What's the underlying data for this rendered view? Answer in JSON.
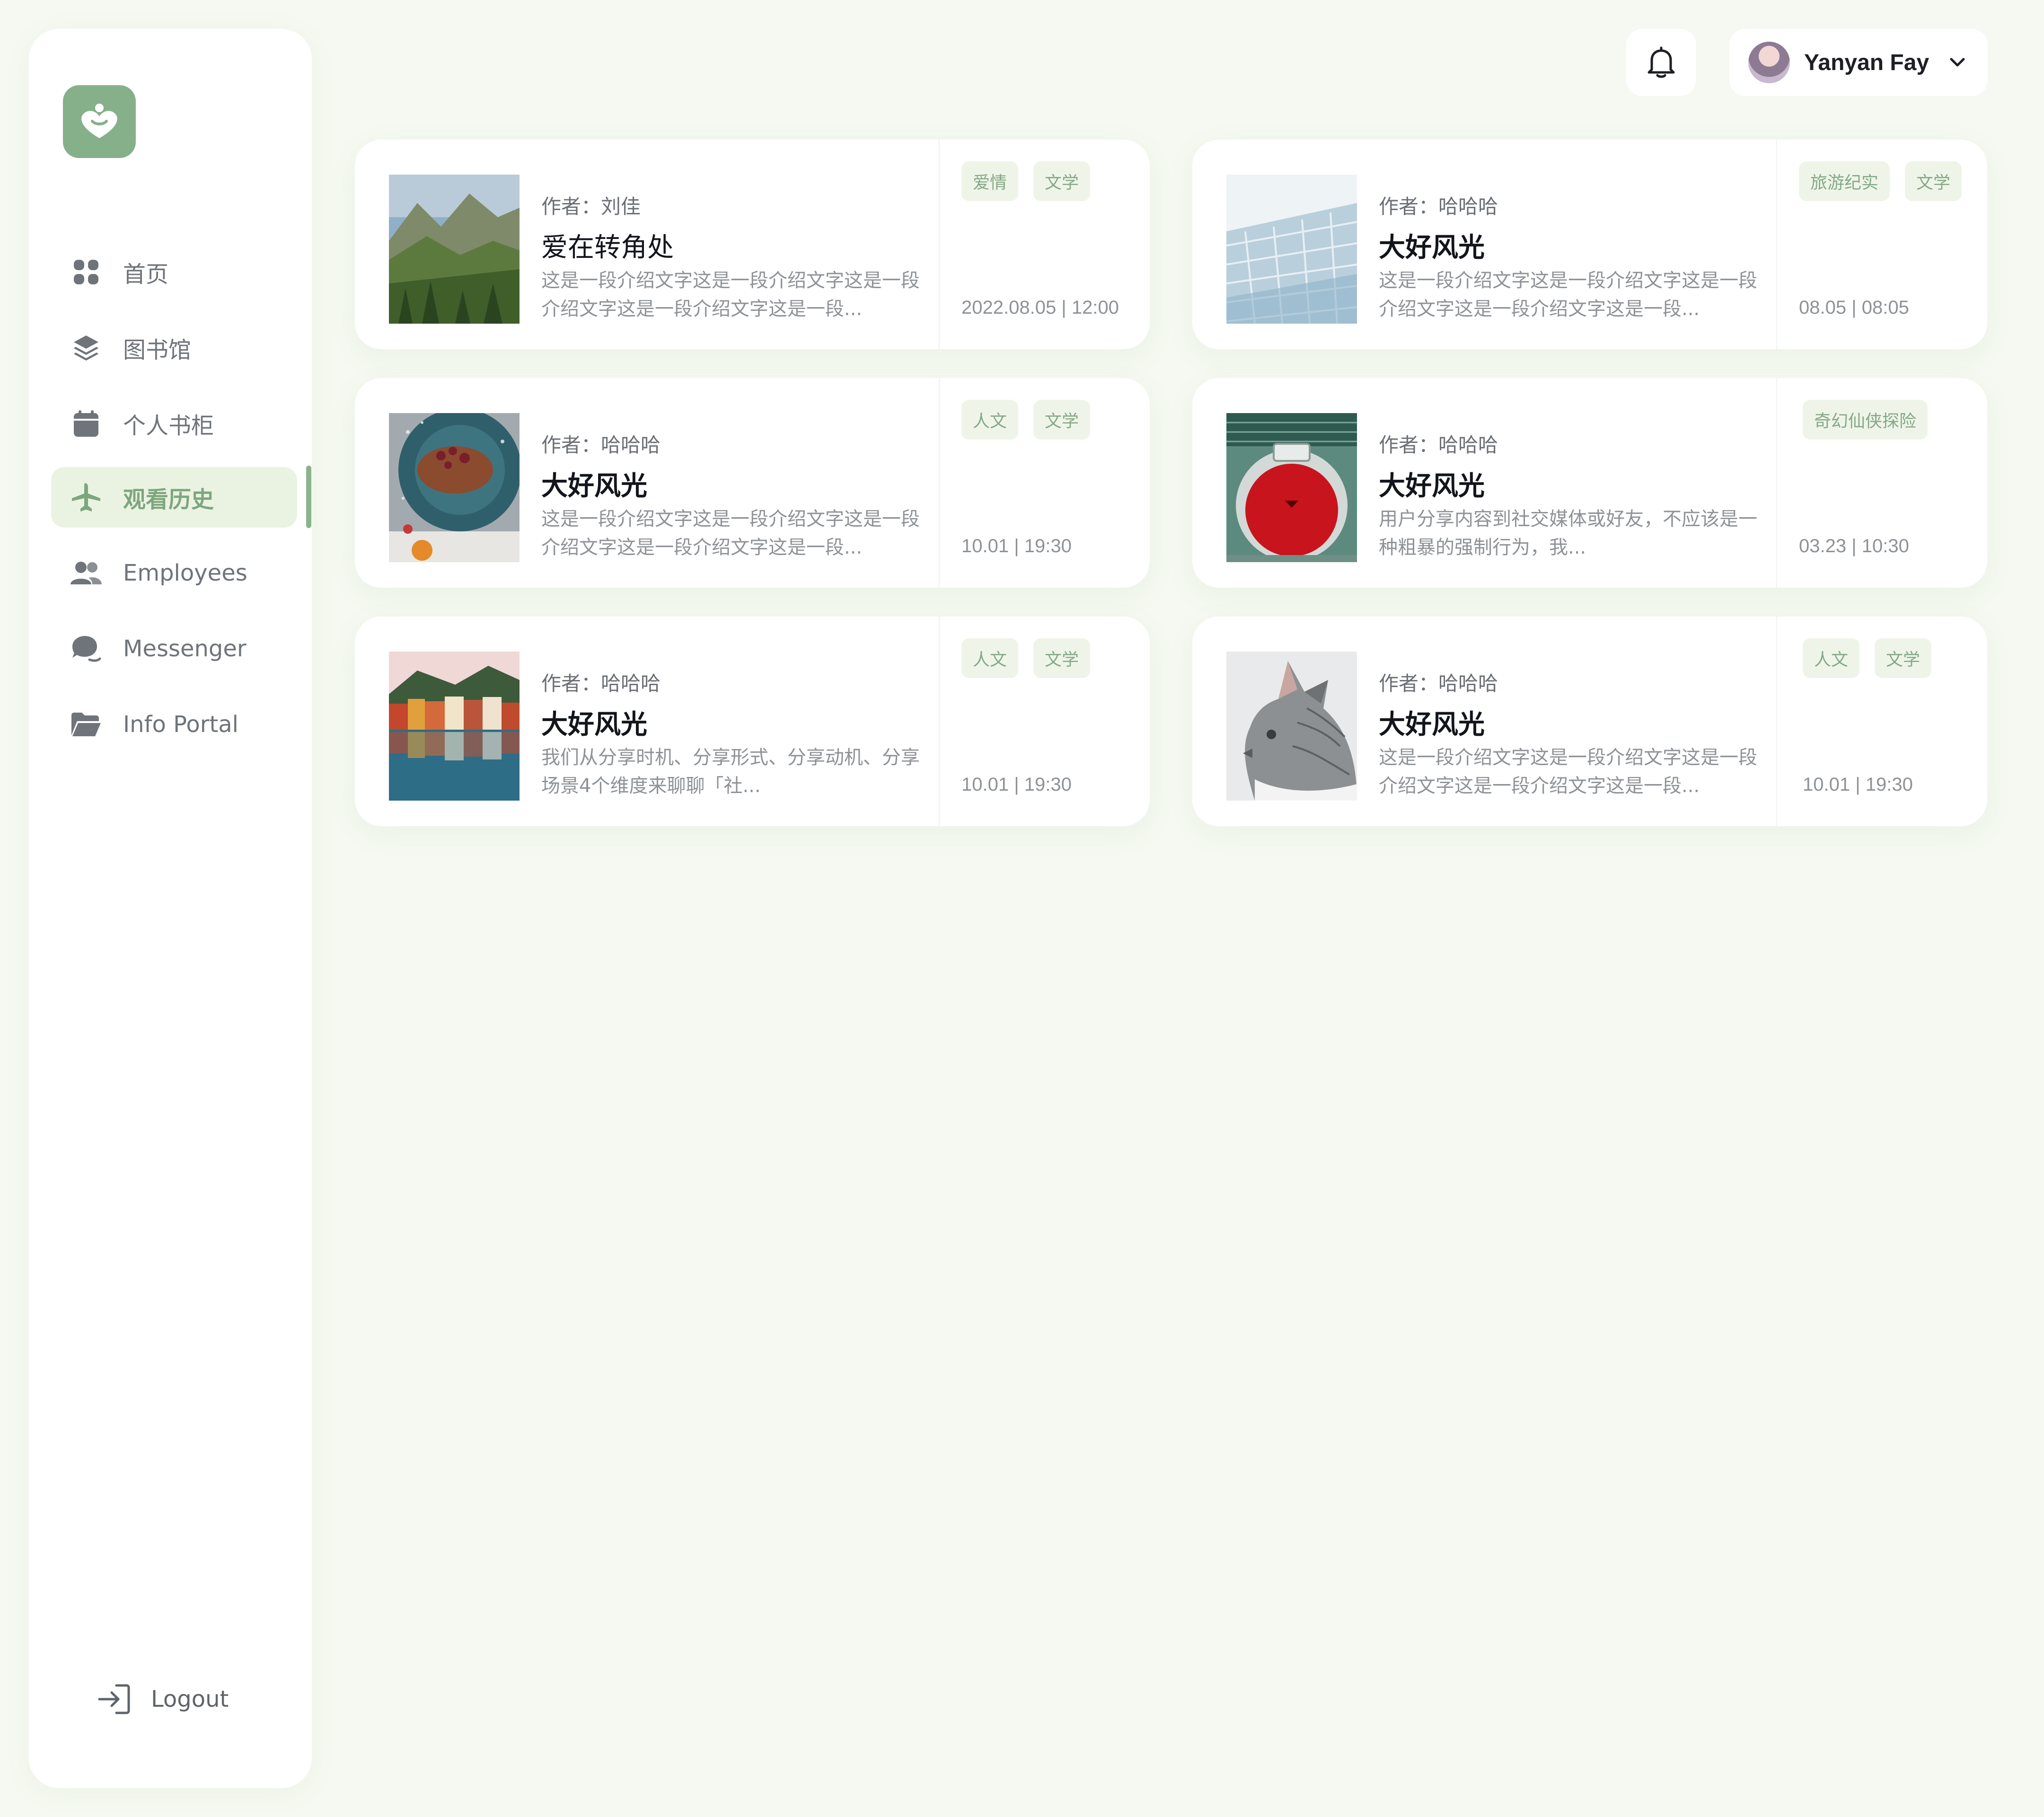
{
  "sidebar": {
    "items": [
      {
        "label": "首页",
        "icon": "grid-icon"
      },
      {
        "label": "图书馆",
        "icon": "layers-icon"
      },
      {
        "label": "个人书柜",
        "icon": "calendar-icon"
      },
      {
        "label": "观看历史",
        "icon": "airplane-icon"
      },
      {
        "label": "Employees",
        "icon": "users-icon"
      },
      {
        "label": "Messenger",
        "icon": "chat-icon"
      },
      {
        "label": "Info Portal",
        "icon": "folder-icon"
      }
    ],
    "active_index": 3,
    "logout_label": "Logout"
  },
  "header": {
    "user_name": "Yanyan Fay"
  },
  "colors": {
    "accent": "#86b08a",
    "background": "#f5f9f1",
    "tag_bg": "#eef5e8",
    "tag_text": "#86a887"
  },
  "cards": [
    {
      "author": "作者：刘佳",
      "title": "爱在转角处",
      "desc": "这是一段介绍文字这是一段介绍文字这是一段介绍文字这是一段介绍文字这是一段...",
      "tags": [
        "爱情",
        "文学"
      ],
      "time": "2022.08.05 | 12:00",
      "image": "mountain-landscape"
    },
    {
      "author": "作者：哈哈哈",
      "title": "大好风光",
      "desc": "这是一段介绍文字这是一段介绍文字这是一段介绍文字这是一段介绍文字这是一段...",
      "tags": [
        "旅游纪实",
        "文学"
      ],
      "time": "08.05 | 08:05",
      "image": "glass-building"
    },
    {
      "author": "作者：哈哈哈",
      "title": "大好风光",
      "desc": "这是一段介绍文字这是一段介绍文字这是一段介绍文字这是一段介绍文字这是一段...",
      "tags": [
        "人文",
        "文学"
      ],
      "time": "10.01 | 19:30",
      "image": "dessert-plate"
    },
    {
      "author": "作者：哈哈哈",
      "title": "大好风光",
      "desc": "用户分享内容到社交媒体或好友，不应该是一种粗暴的强制行为，我...",
      "tags": [
        "奇幻仙侠探险"
      ],
      "time": "03.23 | 10:30",
      "image": "red-round-door"
    },
    {
      "author": "作者：哈哈哈",
      "title": "大好风光",
      "desc": "我们从分享时机、分享形式、分享动机、分享场景4个维度来聊聊「社...",
      "tags": [
        "人文",
        "文学"
      ],
      "time": "10.01 | 19:30",
      "image": "lakeside-town"
    },
    {
      "author": "作者：哈哈哈",
      "title": "大好风光",
      "desc": "这是一段介绍文字这是一段介绍文字这是一段介绍文字这是一段介绍文字这是一段...",
      "tags": [
        "人文",
        "文学"
      ],
      "time": "10.01 | 19:30",
      "image": "gray-cat"
    }
  ]
}
